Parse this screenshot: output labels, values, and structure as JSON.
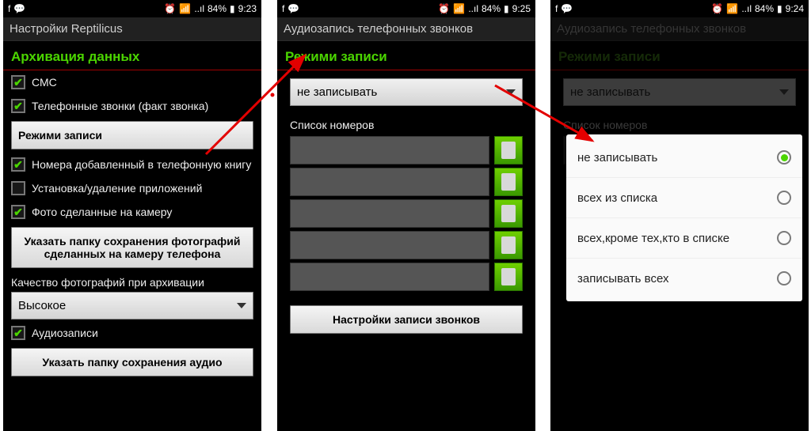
{
  "status": {
    "left_icons": [
      "f",
      "💬"
    ],
    "right_icons": [
      "⏰",
      "📶",
      "📶"
    ],
    "battery": "84%",
    "time1": "9:23",
    "time2": "9:25",
    "time3": "9:24"
  },
  "p1": {
    "appbar": "Настройки Reptilicus",
    "section": "Архивация данных",
    "items": [
      {
        "label": "СМС",
        "checked": true
      },
      {
        "label": "Телефонные звонки (факт звонка)",
        "checked": true
      }
    ],
    "modes_btn": "Режими записи",
    "items2": [
      {
        "label": "Номера добавленный в телефонную книгу",
        "checked": true
      },
      {
        "label": "Установка/удаление приложений",
        "checked": false
      },
      {
        "label": "Фото сделанные на камеру",
        "checked": true
      }
    ],
    "photo_folder_btn": "Указать папку сохранения фотографий сделанных на камеру телефона",
    "quality_label": "Качество фотографий при архивации",
    "quality_value": "Высокое",
    "audio_item": {
      "label": "Аудиозаписи",
      "checked": true
    },
    "audio_folder_btn": "Указать папку сохранения аудио"
  },
  "p2": {
    "appbar": "Аудиозапись телефонных звонков",
    "section": "Режими записи",
    "dropdown": "не записывать",
    "list_label": "Список номеров",
    "settings_btn": "Настройки записи звонков"
  },
  "p3": {
    "appbar": "Аудиозапись телефонных звонков",
    "section": "Режими записи",
    "dropdown": "не записывать",
    "list_label": "Список номеров",
    "popup": [
      {
        "label": "не записывать",
        "selected": true
      },
      {
        "label": "всех из списка",
        "selected": false
      },
      {
        "label": "всех,кроме тех,кто в списке",
        "selected": false
      },
      {
        "label": "записывать всех",
        "selected": false
      }
    ]
  }
}
